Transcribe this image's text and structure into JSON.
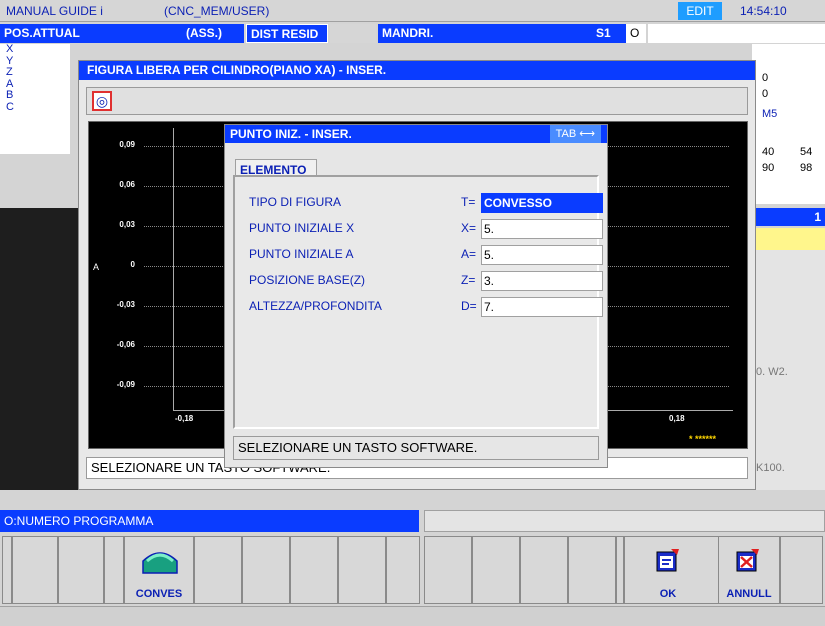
{
  "topbar": {
    "app": "MANUAL GUIDE i",
    "path": "(CNC_MEM/USER)",
    "mode": "EDIT",
    "time": "14:54:10"
  },
  "header": {
    "pos_label": "POS.ATTUAL",
    "pos_mode": "(ASS.)",
    "dist_label": "DIST RESID",
    "spindle_label": "MANDRI.",
    "spindle_id": "S1",
    "spindle_val": "O"
  },
  "axes": [
    "X",
    "Y",
    "Z",
    "A",
    "B",
    "C"
  ],
  "right_panel": {
    "v1": "0",
    "v2": "0",
    "m": "M5",
    "r1a": "40",
    "r1b": "54",
    "r2a": "90",
    "r2b": "98",
    "counter": "1",
    "w2": "0. W2.",
    "k100": "K100."
  },
  "dialog": {
    "title": "FIGURA LIBERA PER CILINDRO(PIANO XA) - INSER.",
    "tool_icon": "target-icon",
    "status": "SELEZIONARE UN TASTO SOFTWARE.",
    "graph": {
      "yticks": [
        "0,09",
        "0,06",
        "0,03",
        "0",
        "-0,03",
        "-0,06",
        "-0,09"
      ],
      "xtick_left": "-0,18",
      "xtick_right": "0,18",
      "axis_label": "A",
      "marker": "* ******"
    }
  },
  "inner": {
    "title": "PUNTO INIZ. - INSER.",
    "tab_hint": "TAB ⟷",
    "tab": "ELEMENTO",
    "fields": [
      {
        "label": "TIPO DI FIGURA",
        "letter": "T=",
        "value": "CONVESSO"
      },
      {
        "label": "PUNTO INIZIALE X",
        "letter": "X=",
        "value": "5."
      },
      {
        "label": "PUNTO INIZIALE A",
        "letter": "A=",
        "value": "5."
      },
      {
        "label": "POSIZIONE BASE(Z)",
        "letter": "Z=",
        "value": "3."
      },
      {
        "label": "ALTEZZA/PROFONDITA",
        "letter": "D=",
        "value": "7."
      }
    ],
    "status": "SELEZIONARE UN TASTO SOFTWARE."
  },
  "bottom": {
    "prog": "O:NUMERO PROGRAMMA"
  },
  "softkeys": {
    "conves": "CONVES",
    "ok": "OK",
    "annull": "ANNULL"
  },
  "colors": {
    "title_blue": "#0a3cff",
    "text_navy": "#0a1fb4",
    "edit_badge": "#1e9dff"
  }
}
